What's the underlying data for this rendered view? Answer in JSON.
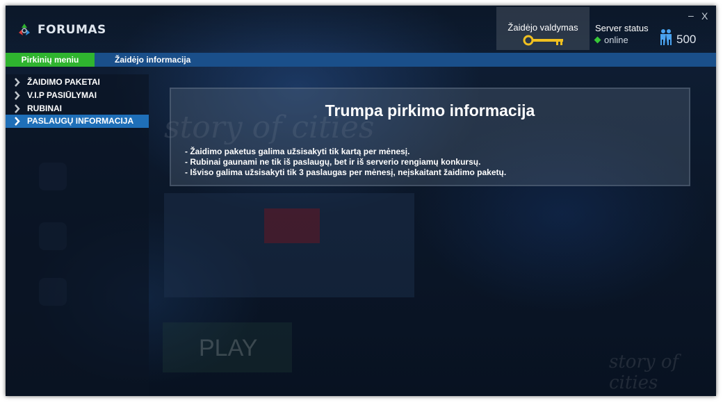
{
  "app": {
    "name": "FORUMAS"
  },
  "header": {
    "control_label": "Žaidėjo valdymas",
    "server_status_label": "Server status",
    "server_status_value": "online",
    "player_count": "500",
    "minimize_symbol": "–",
    "close_symbol": "X"
  },
  "tabs": [
    {
      "label": "Pirkinių meniu"
    },
    {
      "label": "Žaidėjo informacija"
    }
  ],
  "sidebar": {
    "items": [
      {
        "label": "ŽAIDIMO PAKETAI"
      },
      {
        "label": "V.I.P PASIŪLYMAI"
      },
      {
        "label": "RUBINAI"
      },
      {
        "label": "PASLAUGŲ INFORMACIJA"
      }
    ]
  },
  "info": {
    "title": "Trumpa pirkimo informacija",
    "lines": [
      "- Žaidimo paketus galima užsisakyti tik kartą per mėnesį.",
      "- Rubinai gaunami ne tik iš paslaugų, bet ir iš serverio rengiamų konkursų.",
      "- Išviso galima užsisakyti tik 3 paslaugas per mėnesį, neįskaitant žaidimo paketų."
    ]
  },
  "colors": {
    "accent_green": "#2fb42f",
    "tab_bar_blue": "#1a4f8a",
    "sidebar_active_blue": "#1f6fb8",
    "online_green": "#37c837"
  },
  "icons": {
    "logo": "recycle-logo-icon",
    "control": "key-icon",
    "players": "players-icon",
    "sidebar": "chevron-right-icon"
  }
}
